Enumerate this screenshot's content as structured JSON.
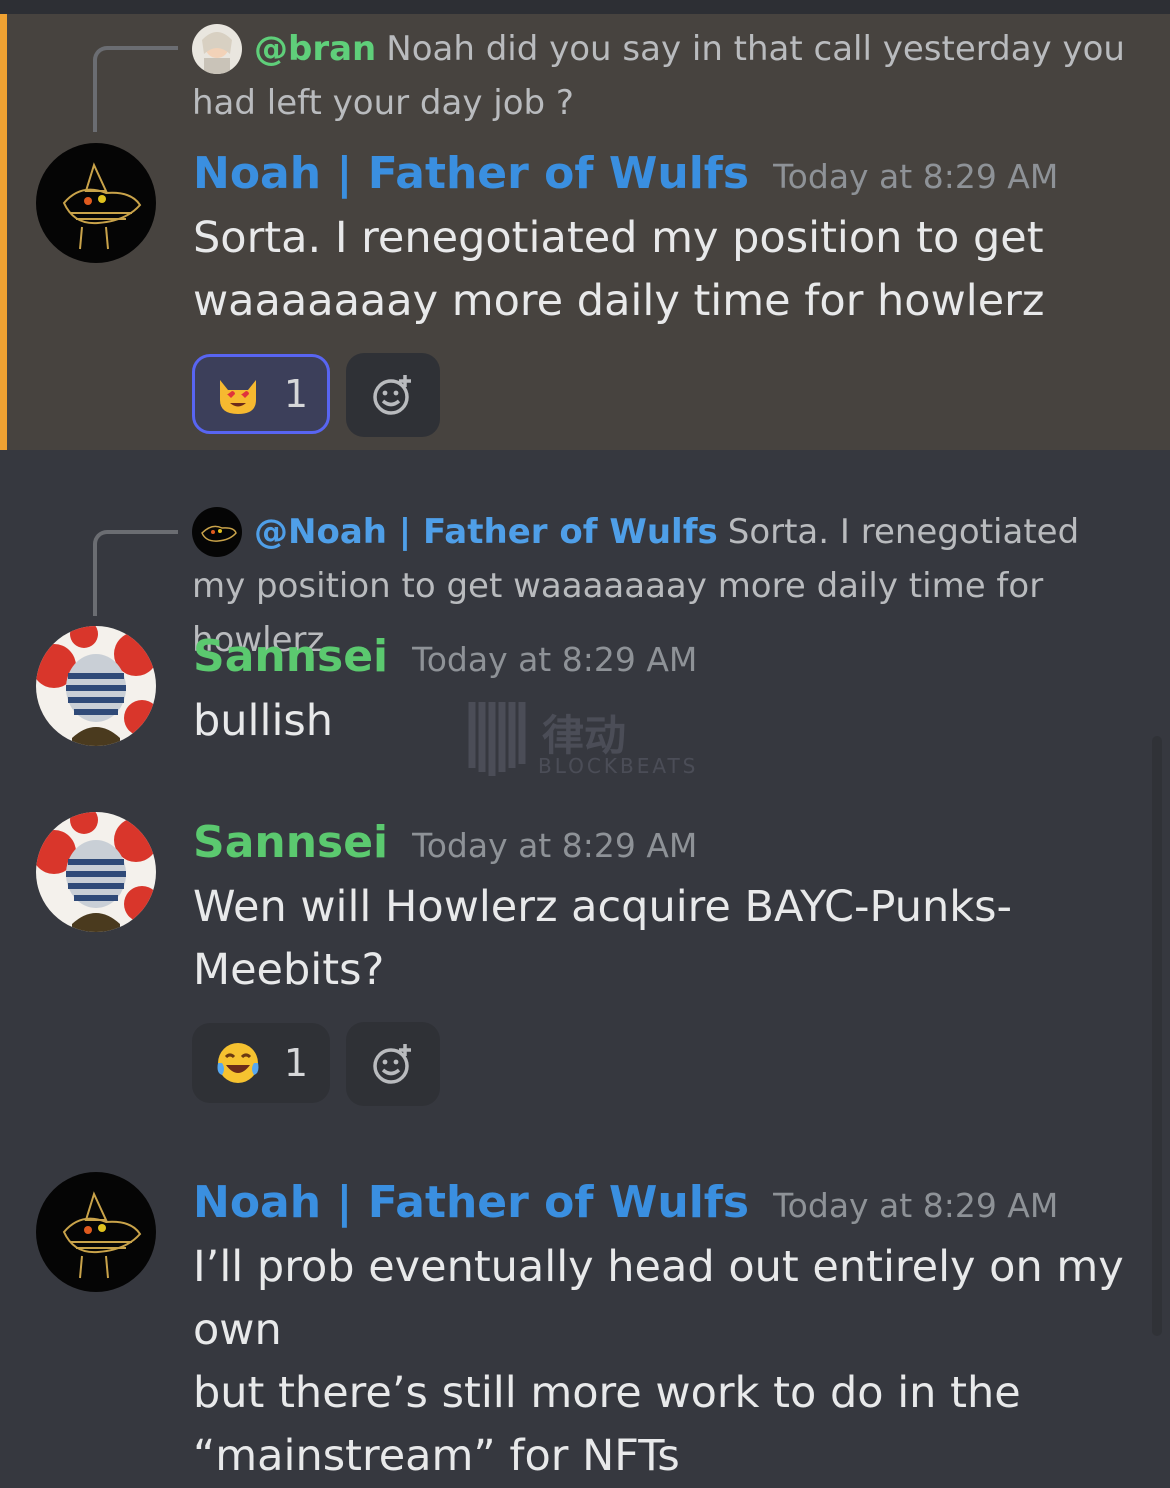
{
  "messages": [
    {
      "reply": {
        "mention": "@bran",
        "text": "Noah did you say in that call yesterday you had left your day job ?"
      },
      "author": "Noah | Father of Wulfs",
      "timestamp": "Today at 8:29 AM",
      "text_lines": [
        "Sorta. I renegotiated my position to get",
        "waaaaaaay more daily time for howlerz"
      ],
      "reaction": {
        "emoji": "heart-eyes-cat-emoji",
        "count": "1"
      },
      "highlighted": true
    },
    {
      "reply": {
        "mention": "@Noah | Father of Wulfs",
        "text": "Sorta. I renegotiated my position to get waaaaaaay more daily time for howlerz"
      },
      "author": "Sannsei",
      "timestamp": "Today at 8:29 AM",
      "text_lines": [
        "bullish"
      ]
    },
    {
      "author": "Sannsei",
      "timestamp": "Today at 8:29 AM",
      "text_lines": [
        "Wen will Howlerz acquire BAYC-Punks-",
        "Meebits?"
      ],
      "reaction": {
        "emoji": "tears-of-joy-emoji",
        "count": "1"
      }
    },
    {
      "author": "Noah | Father of Wulfs",
      "timestamp": "Today at 8:29 AM",
      "text_lines": [
        "I’ll prob eventually head out entirely on my own",
        "but there’s still more work to do in the",
        "“mainstream” for NFTs"
      ]
    }
  ],
  "watermark": {
    "text": "BLOCKBEATS",
    "glyph": "律动"
  },
  "colors": {
    "highlight_bar": "#f0a232",
    "noah_name": "#3a8fe0",
    "sannsei_name": "#5bc96f",
    "reaction_active_border": "#5865f2"
  }
}
